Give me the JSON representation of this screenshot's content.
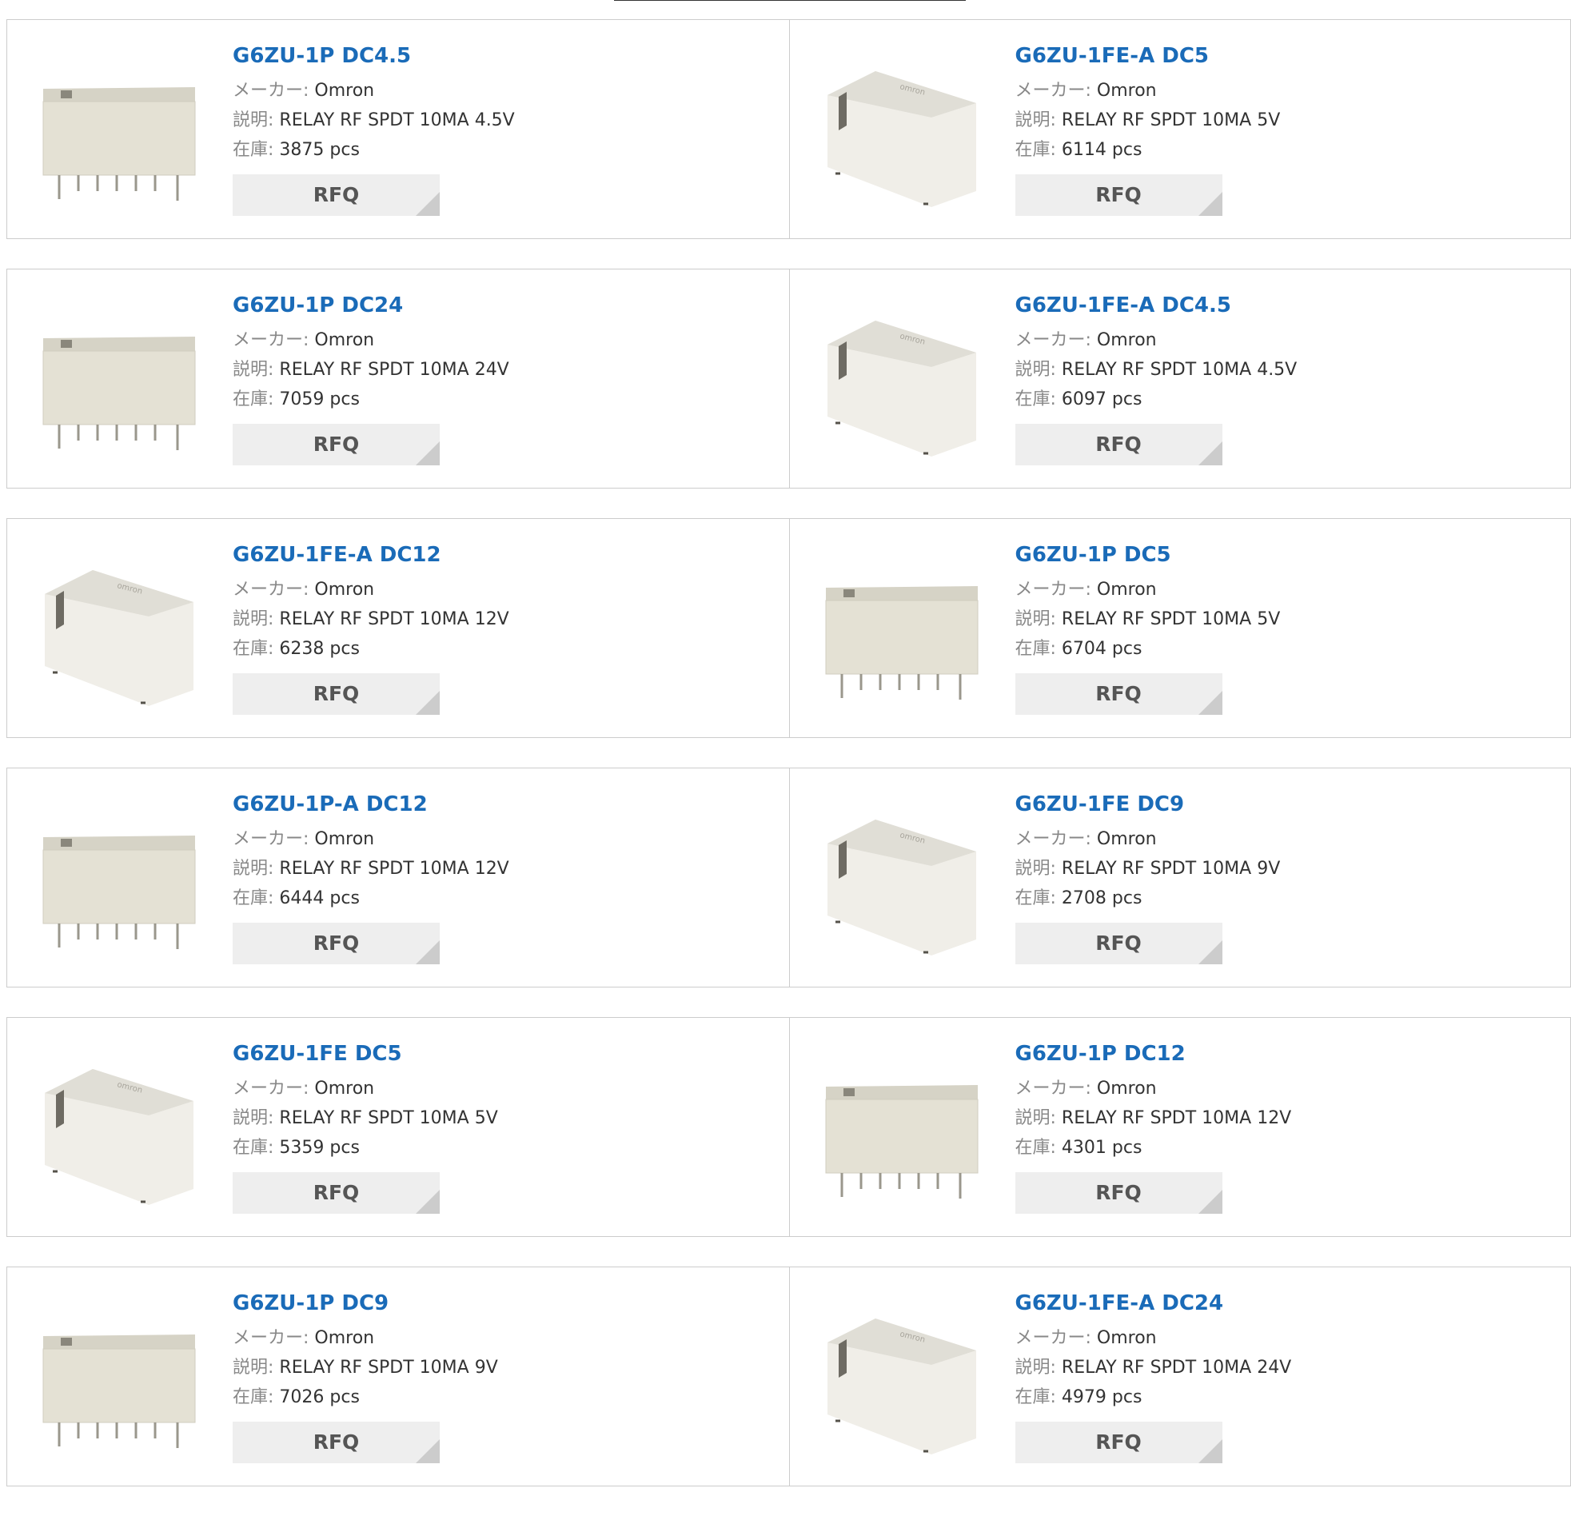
{
  "labels": {
    "maker": "メーカー:",
    "desc": "説明:",
    "stock": "在庫:",
    "rfq": "RFQ"
  },
  "products": [
    {
      "pn": "G6ZU-1P DC4.5",
      "maker": "Omron",
      "desc": "RELAY RF SPDT 10MA 4.5V",
      "stock": "3875 pcs",
      "image": "relay-pcb-pins-image"
    },
    {
      "pn": "G6ZU-1FE-A DC5",
      "maker": "Omron",
      "desc": "RELAY RF SPDT 10MA 5V",
      "stock": "6114 pcs",
      "image": "relay-smd-image"
    },
    {
      "pn": "G6ZU-1P DC24",
      "maker": "Omron",
      "desc": "RELAY RF SPDT 10MA 24V",
      "stock": "7059 pcs",
      "image": "relay-pcb-pins-image"
    },
    {
      "pn": "G6ZU-1FE-A DC4.5",
      "maker": "Omron",
      "desc": "RELAY RF SPDT 10MA 4.5V",
      "stock": "6097 pcs",
      "image": "relay-smd-image"
    },
    {
      "pn": "G6ZU-1FE-A DC12",
      "maker": "Omron",
      "desc": "RELAY RF SPDT 10MA 12V",
      "stock": "6238 pcs",
      "image": "relay-smd-image"
    },
    {
      "pn": "G6ZU-1P DC5",
      "maker": "Omron",
      "desc": "RELAY RF SPDT 10MA 5V",
      "stock": "6704 pcs",
      "image": "relay-pcb-pins-image"
    },
    {
      "pn": "G6ZU-1P-A DC12",
      "maker": "Omron",
      "desc": "RELAY RF SPDT 10MA 12V",
      "stock": "6444 pcs",
      "image": "relay-pcb-pins-image"
    },
    {
      "pn": "G6ZU-1FE DC9",
      "maker": "Omron",
      "desc": "RELAY RF SPDT 10MA 9V",
      "stock": "2708 pcs",
      "image": "relay-smd-image"
    },
    {
      "pn": "G6ZU-1FE DC5",
      "maker": "Omron",
      "desc": "RELAY RF SPDT 10MA 5V",
      "stock": "5359 pcs",
      "image": "relay-smd-image"
    },
    {
      "pn": "G6ZU-1P DC12",
      "maker": "Omron",
      "desc": "RELAY RF SPDT 10MA 12V",
      "stock": "4301 pcs",
      "image": "relay-pcb-pins-image"
    },
    {
      "pn": "G6ZU-1P DC9",
      "maker": "Omron",
      "desc": "RELAY RF SPDT 10MA 9V",
      "stock": "7026 pcs",
      "image": "relay-pcb-pins-image"
    },
    {
      "pn": "G6ZU-1FE-A DC24",
      "maker": "Omron",
      "desc": "RELAY RF SPDT 10MA 24V",
      "stock": "4979 pcs",
      "image": "relay-smd-image"
    }
  ],
  "colors": {
    "link": "#1a6bb8",
    "border": "#cccccc",
    "button_bg": "#eeeeee",
    "button_text": "#555555",
    "label": "#888888"
  }
}
